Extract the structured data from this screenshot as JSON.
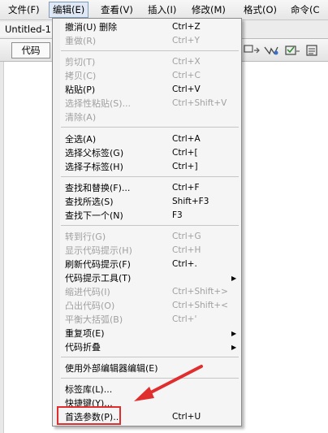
{
  "menubar": {
    "items": [
      {
        "label": "文件(F)"
      },
      {
        "label": "编辑(E)"
      },
      {
        "label": "查看(V)"
      },
      {
        "label": "插入(I)"
      },
      {
        "label": "修改(M)"
      },
      {
        "label": "格式(O)"
      },
      {
        "label": "命令(C"
      }
    ]
  },
  "document": {
    "tab_label": "Untitled-1"
  },
  "toolbar": {
    "code_label": "代码"
  },
  "edit_menu": {
    "items": [
      {
        "label": "撤消(U) 删除",
        "shortcut": "Ctrl+Z",
        "enabled": true
      },
      {
        "label": "重做(R)",
        "shortcut": "Ctrl+Y",
        "enabled": false
      },
      {
        "label": "剪切(T)",
        "shortcut": "Ctrl+X",
        "enabled": false
      },
      {
        "label": "拷贝(C)",
        "shortcut": "Ctrl+C",
        "enabled": false
      },
      {
        "label": "粘贴(P)",
        "shortcut": "Ctrl+V",
        "enabled": true
      },
      {
        "label": "选择性粘贴(S)...",
        "shortcut": "Ctrl+Shift+V",
        "enabled": false
      },
      {
        "label": "清除(A)",
        "shortcut": "",
        "enabled": false
      },
      {
        "label": "全选(A)",
        "shortcut": "Ctrl+A",
        "enabled": true
      },
      {
        "label": "选择父标签(G)",
        "shortcut": "Ctrl+[",
        "enabled": true
      },
      {
        "label": "选择子标签(H)",
        "shortcut": "Ctrl+]",
        "enabled": true
      },
      {
        "label": "查找和替换(F)...",
        "shortcut": "Ctrl+F",
        "enabled": true
      },
      {
        "label": "查找所选(S)",
        "shortcut": "Shift+F3",
        "enabled": true
      },
      {
        "label": "查找下一个(N)",
        "shortcut": "F3",
        "enabled": true
      },
      {
        "label": "转到行(G)",
        "shortcut": "Ctrl+G",
        "enabled": false
      },
      {
        "label": "显示代码提示(H)",
        "shortcut": "Ctrl+H",
        "enabled": false
      },
      {
        "label": "刷新代码提示(F)",
        "shortcut": "Ctrl+.",
        "enabled": true
      },
      {
        "label": "代码提示工具(T)",
        "shortcut": "",
        "enabled": true,
        "submenu": true
      },
      {
        "label": "缩进代码(I)",
        "shortcut": "Ctrl+Shift+>",
        "enabled": false
      },
      {
        "label": "凸出代码(O)",
        "shortcut": "Ctrl+Shift+<",
        "enabled": false
      },
      {
        "label": "平衡大括弧(B)",
        "shortcut": "Ctrl+'",
        "enabled": false
      },
      {
        "label": "重复项(E)",
        "shortcut": "",
        "enabled": true,
        "submenu": true
      },
      {
        "label": "代码折叠",
        "shortcut": "",
        "enabled": true,
        "submenu": true
      },
      {
        "label": "使用外部编辑器编辑(E)",
        "shortcut": "",
        "enabled": true
      },
      {
        "label": "标签库(L)...",
        "shortcut": "",
        "enabled": true
      },
      {
        "label": "快捷键(Y)...",
        "shortcut": "",
        "enabled": true
      },
      {
        "label": "首选参数(P)...",
        "shortcut": "Ctrl+U",
        "enabled": true
      }
    ],
    "submenu_arrow": "▶"
  },
  "annotation": {
    "color": "#e02d2d"
  }
}
